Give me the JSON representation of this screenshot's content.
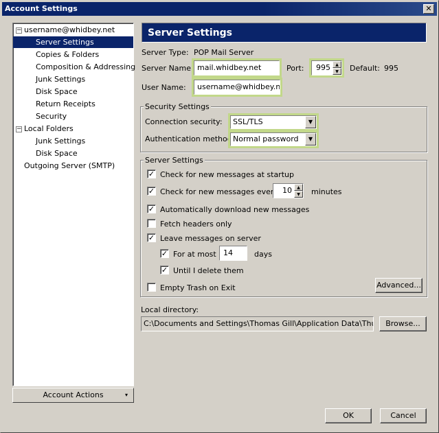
{
  "window": {
    "title": "Account Settings",
    "close_glyph": "✕"
  },
  "tree": {
    "items": [
      {
        "label": "username@whidbey.net",
        "expander": "−"
      },
      {
        "label": "Server Settings"
      },
      {
        "label": "Copies & Folders"
      },
      {
        "label": "Composition & Addressing"
      },
      {
        "label": "Junk Settings"
      },
      {
        "label": "Disk Space"
      },
      {
        "label": "Return Receipts"
      },
      {
        "label": "Security"
      },
      {
        "label": "Local Folders",
        "expander": "−"
      },
      {
        "label": "Junk Settings"
      },
      {
        "label": "Disk Space"
      },
      {
        "label": "Outgoing Server (SMTP)"
      }
    ],
    "selected_index": 1
  },
  "account_actions": {
    "label": "Account Actions",
    "arrow": "▾"
  },
  "panel": {
    "title": "Server Settings",
    "server_type_label": "Server Type:",
    "server_type_value": "POP Mail Server",
    "server_name_label": "Server Name:",
    "server_name_value": "mail.whidbey.net",
    "port_label": "Port:",
    "port_value": "995",
    "default_label": "Default:",
    "default_value": "995",
    "user_name_label": "User Name:",
    "user_name_value": "username@whidbey.net"
  },
  "security": {
    "group_title": "Security Settings",
    "connection_label": "Connection security:",
    "connection_value": "SSL/TLS",
    "auth_label": "Authentication method:",
    "auth_value": "Normal password"
  },
  "server_settings": {
    "group_title": "Server Settings",
    "check_startup": {
      "label": "Check for new messages at startup",
      "checked": true
    },
    "check_every": {
      "label": "Check for new messages every",
      "checked": true,
      "value": "10",
      "unit": "minutes"
    },
    "auto_download": {
      "label": "Automatically download new messages",
      "checked": true
    },
    "fetch_headers": {
      "label": "Fetch headers only",
      "checked": false
    },
    "leave_on_server": {
      "label": "Leave messages on server",
      "checked": true
    },
    "for_at_most": {
      "label": "For at most",
      "checked": true,
      "value": "14",
      "unit": "days"
    },
    "until_delete": {
      "label": "Until I delete them",
      "checked": true
    },
    "empty_trash": {
      "label": "Empty Trash on Exit",
      "checked": false
    },
    "advanced_label": "Advanced..."
  },
  "local_dir": {
    "label": "Local directory:",
    "value": "C:\\Documents and Settings\\Thomas Gill\\Application Data\\Thunderbird",
    "browse_label": "Browse..."
  },
  "buttons": {
    "ok": "OK",
    "cancel": "Cancel"
  },
  "check_glyph": "✓",
  "spin_up": "▲",
  "spin_down": "▼",
  "dropdown_glyph": "▼"
}
